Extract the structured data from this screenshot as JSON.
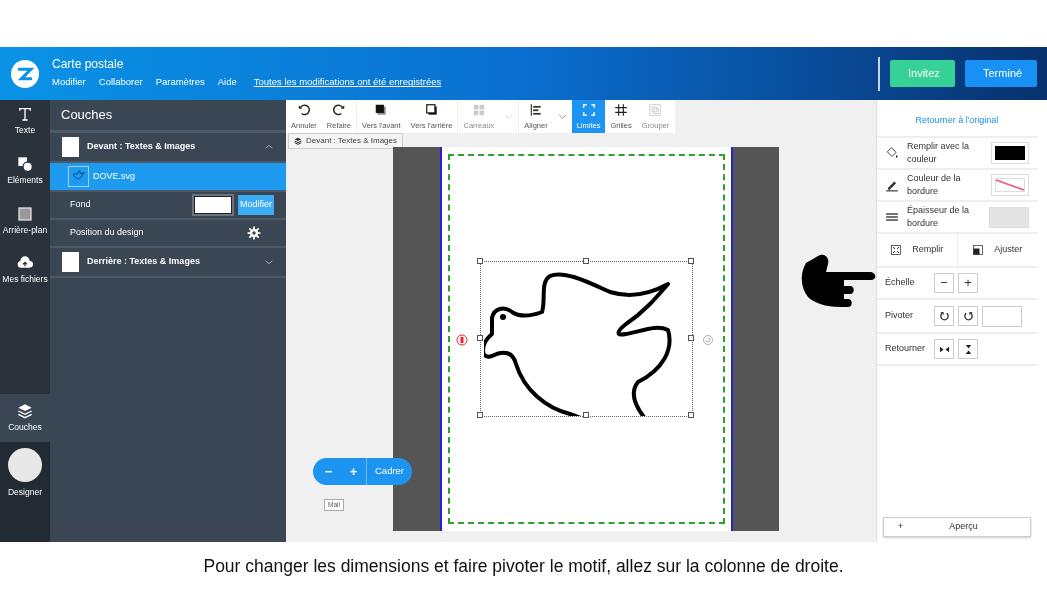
{
  "window": {
    "title": "Carte postale"
  },
  "menu": [
    {
      "label": "Modifier"
    },
    {
      "label": "Collaborer"
    },
    {
      "label": "Paramètres"
    },
    {
      "label": "Aide"
    }
  ],
  "save_status": "Toutes les modifications ont été enregistrées",
  "header_buttons": [
    {
      "label": "Invitez",
      "kind": "invite"
    },
    {
      "label": "Terminé",
      "kind": "done"
    }
  ],
  "rail": [
    {
      "label": "Texte",
      "selected": false
    },
    {
      "label": "Eléments",
      "selected": false
    },
    {
      "label": "Arrière-plan",
      "selected": false
    },
    {
      "label": "Mes fichiers",
      "selected": false
    },
    {
      "label": "Couches",
      "selected": true
    }
  ],
  "designer": {
    "label": "Designer"
  },
  "layers_panel": {
    "title": "Couches",
    "groups": [
      {
        "label": "Devant : Textes & Images",
        "expanded": true,
        "children": [
          {
            "label": "DOVE.svg",
            "selected": true
          }
        ],
        "background": {
          "label": "Fond",
          "button": "Modifier"
        },
        "position": {
          "label": "Position du design"
        }
      },
      {
        "label": "Derrière : Textes & Images",
        "expanded": false
      }
    ]
  },
  "toolbar": [
    {
      "label": "Annuler",
      "disabled": false,
      "selected": false,
      "dropdown": false
    },
    {
      "label": "Refaire",
      "disabled": false,
      "selected": false,
      "dropdown": false
    },
    {
      "label": "Vers l'avant",
      "disabled": false,
      "selected": false,
      "dropdown": false
    },
    {
      "label": "Vers l'arrière",
      "disabled": false,
      "selected": false,
      "dropdown": false
    },
    {
      "label": "Carreaux",
      "disabled": true,
      "selected": false,
      "dropdown": true
    },
    {
      "label": "Aligner",
      "disabled": false,
      "selected": false,
      "dropdown": true
    },
    {
      "label": "Limites",
      "disabled": false,
      "selected": true,
      "dropdown": false
    },
    {
      "label": "Grilles",
      "disabled": false,
      "selected": false,
      "dropdown": false
    },
    {
      "label": "Grouper",
      "disabled": true,
      "selected": false,
      "dropdown": false
    }
  ],
  "canvas": {
    "side_tab": "Devant : Textes & Images",
    "zoom_buttons": [
      "−",
      "+"
    ],
    "fit_button": "Cadrer",
    "mail_tag": "Mail"
  },
  "properties": {
    "reset": "Retourner à l'original",
    "rows": [
      {
        "kind": "fill_color",
        "label": "Remplir avec la couleur",
        "color": "#000000"
      },
      {
        "kind": "border_color",
        "label": "Couleur de la bordure"
      },
      {
        "kind": "border_width",
        "label": "Épaisseur de la bordure"
      },
      {
        "kind": "fit",
        "buttons": [
          "Remplir",
          "Ajuster"
        ]
      },
      {
        "kind": "scale",
        "label": "Échelle",
        "buttons": [
          "−",
          "+"
        ]
      },
      {
        "kind": "rotate",
        "label": "Pivoter"
      },
      {
        "kind": "flip",
        "label": "Retourner"
      }
    ]
  },
  "preview": {
    "icon": "+",
    "label": "Aperçu"
  },
  "caption": "Pour changer les dimensions et faire pivoter le motif, allez sur la colonne de droite."
}
